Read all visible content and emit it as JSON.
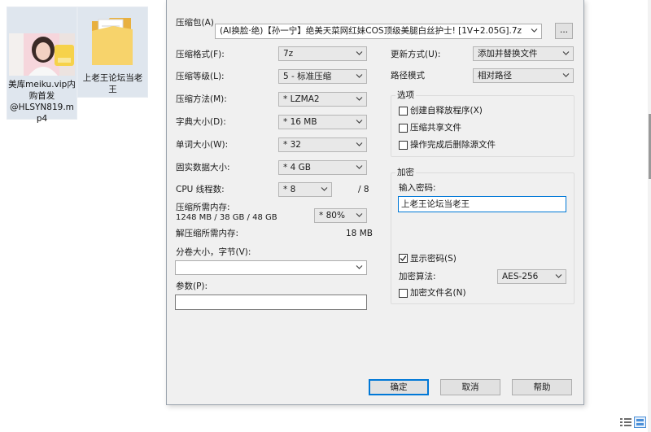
{
  "desktop": {
    "files": [
      {
        "name": "美库meiku.vip内购首发@HLSYN819.mp4",
        "lines": [
          "美库meiku.vip内",
          "购首发",
          "@HLSYN819.m",
          "p4"
        ],
        "icon": "video-thumbnail-icon"
      },
      {
        "name": "上老王论坛当老王",
        "lines": [
          "上老王论坛当老",
          "王"
        ],
        "icon": "folder-icon"
      }
    ]
  },
  "dialog": {
    "archive_label": "压缩包(A)",
    "archive_path": "(AI换脸·绝)【孙一宁】绝美天菜网红妹COS顶级美腿白丝护士! [1V+2.05G].7z",
    "browse_label": "...",
    "format_label": "压缩格式(F):",
    "format_value": "7z",
    "level_label": "压缩等级(L):",
    "level_value": "5 - 标准压缩",
    "method_label": "压缩方法(M):",
    "method_value": "* LZMA2",
    "dict_label": "字典大小(D):",
    "dict_value": "* 16 MB",
    "word_label": "单词大小(W):",
    "word_value": "* 32",
    "solid_label": "固实数据大小:",
    "solid_value": "* 4 GB",
    "cpu_label": "CPU 线程数:",
    "cpu_value": "* 8",
    "cpu_max": "/ 8",
    "mem_label": "压缩所需内存:",
    "mem_detail": "1248 MB / 38 GB / 48 GB",
    "mem_value": "* 80%",
    "decomp_label": "解压缩所需内存:",
    "decomp_value": "18 MB",
    "split_label": "分卷大小，字节(V):",
    "split_value": "",
    "params_label": "参数(P):",
    "params_value": "",
    "update_label": "更新方式(U):",
    "update_value": "添加并替换文件",
    "path_label": "路径模式",
    "path_value": "相对路径",
    "options": {
      "title": "选项",
      "sfx": "创建自释放程序(X)",
      "shared": "压缩共享文件",
      "delete": "操作完成后删除源文件"
    },
    "encryption": {
      "title": "加密",
      "password_label": "输入密码:",
      "password_value": "上老王论坛当老王",
      "show_password": "显示密码(S)",
      "show_password_checked": true,
      "method_label": "加密算法:",
      "method_value": "AES-256",
      "encrypt_names": "加密文件名(N)",
      "encrypt_names_checked": false
    },
    "buttons": {
      "ok": "确定",
      "cancel": "取消",
      "help": "帮助"
    }
  },
  "colors": {
    "accent": "#0078d7",
    "dialog_bg": "#f0f0f0",
    "selection_bg": "#dfe6ee"
  }
}
